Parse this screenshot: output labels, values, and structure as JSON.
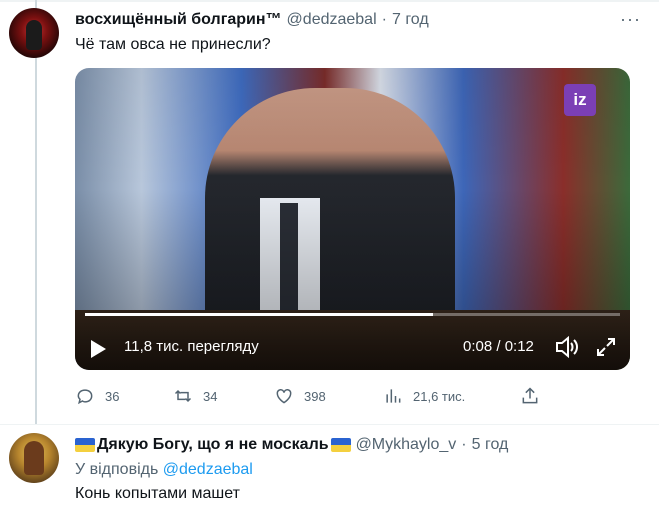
{
  "tweet": {
    "author_name": "восхищённый болгарин™",
    "author_handle": "@dedzaebal",
    "separator": "·",
    "time": "7 год",
    "more_label": "···",
    "text": "Чё там овса не принесли?",
    "video": {
      "logo_text": "iz",
      "views": "11,8 тис. перегляду",
      "time": "0:08 / 0:12",
      "progress": 0.65
    },
    "actions": {
      "replies": "36",
      "retweets": "34",
      "likes": "398",
      "views": "21,6 тис."
    }
  },
  "reply": {
    "author_name": "Дякую Богу, що я не москаль",
    "author_handle": "@Mykhaylo_v",
    "separator": "·",
    "time": "5 год",
    "reply_prefix": "У відповідь",
    "reply_to": "@dedzaebal",
    "text": "Конь копытами машет"
  },
  "colors": {
    "text": "#0f1419",
    "muted": "#536471",
    "link": "#1d9bf0",
    "divider": "#eff3f4",
    "thread_line": "#cfd9de"
  }
}
